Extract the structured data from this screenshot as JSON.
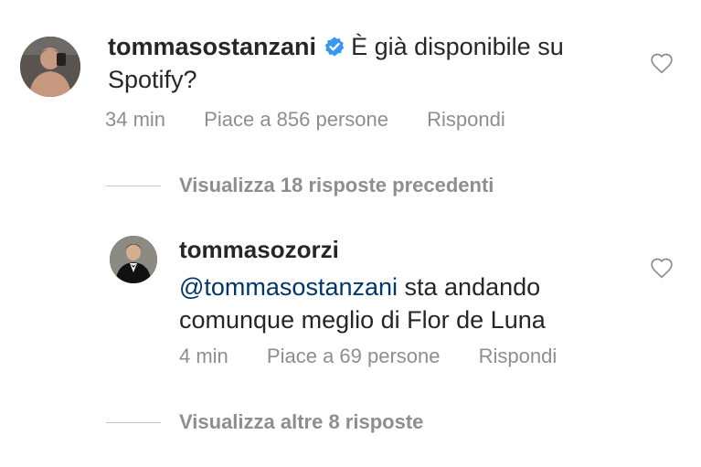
{
  "comments": [
    {
      "username": "tommasostanzani",
      "verified": true,
      "text": "È già disponibile su Spotify?",
      "time": "34 min",
      "likes": "Piace a 856 persone",
      "reply": "Rispondi"
    },
    {
      "username": "tommasozorzi",
      "verified": false,
      "mention": "@tommasostanzani",
      "text_after_mention": " sta andando comunque meglio di Flor de Luna",
      "time": "4 min",
      "likes": "Piace a 69 persone",
      "reply": "Rispondi"
    }
  ],
  "view_previous": "Visualizza 18 risposte precedenti",
  "view_more": "Visualizza altre 8 risposte",
  "colors": {
    "text": "#262626",
    "meta": "#8e8e8e",
    "mention": "#00376b",
    "verified": "#3897f0"
  },
  "icons": {
    "heart": "heart-outline-icon",
    "verified": "verified-badge-icon"
  }
}
